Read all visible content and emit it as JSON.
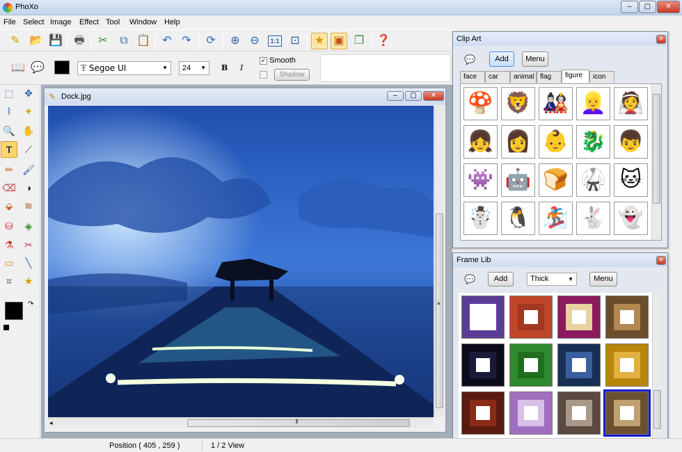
{
  "app": {
    "title": "PhoXo",
    "min": "–",
    "max": "▢",
    "close": "✕"
  },
  "menu": [
    "File",
    "Select",
    "Image",
    "Effect",
    "Tool",
    "Window",
    "Help"
  ],
  "format_bar": {
    "font_glyph": "Ŧ",
    "font_name": "Segoe UI",
    "font_size": "24",
    "bold": "B",
    "italic": "I",
    "smooth_label": "Smooth",
    "smooth_checked": true,
    "shadow_label": "Shadow",
    "shadow_checked": false,
    "text_color": "#000000"
  },
  "document": {
    "title": "Dock.jpg",
    "min": "–",
    "max": "▢",
    "close": "✕"
  },
  "clipart": {
    "title": "Clip Art",
    "close": "✕",
    "add_label": "Add",
    "menu_label": "Menu",
    "tabs": [
      "face",
      "car",
      "animal",
      "flag",
      "figure",
      "icon"
    ],
    "selected_tab": "figure",
    "items": [
      "🍄",
      "🦁",
      "🎎",
      "👱‍♀️",
      "👰",
      "👧",
      "👩",
      "👶",
      "🐉",
      "👦",
      "👾",
      "🤖",
      "🍞",
      "🥋",
      "🐱",
      "☃️",
      "🐧",
      "🏂",
      "🐇",
      "👻"
    ]
  },
  "framelib": {
    "title": "Frame Lib",
    "close": "✕",
    "add_label": "Add",
    "style_value": "Thick",
    "menu_label": "Menu",
    "frames": [
      {
        "outer": "#5a3c96",
        "inner": "#ffffff",
        "center": "#ffffff"
      },
      {
        "outer": "#c0462a",
        "inner": "#a33820",
        "center": "#ffffff"
      },
      {
        "outer": "#8c1a5e",
        "inner": "#e8d2a0",
        "center": "#ffffff"
      },
      {
        "outer": "#6b4d2a",
        "inner": "#b08850",
        "center": "#ffffff"
      },
      {
        "outer": "#0b0b1a",
        "inner": "#1a1a3a",
        "center": "#ffffff"
      },
      {
        "outer": "#2e8a2e",
        "inner": "#1f6e1f",
        "center": "#ffffff"
      },
      {
        "outer": "#1a2f55",
        "inner": "#3a5fa0",
        "center": "#ffffff"
      },
      {
        "outer": "#b8860b",
        "inner": "#e0b040",
        "center": "#ffffff"
      },
      {
        "outer": "#5a1a10",
        "inner": "#8a2a18",
        "center": "#ffffff"
      },
      {
        "outer": "#a070c0",
        "inner": "#d8c0e8",
        "center": "#ffffff"
      },
      {
        "outer": "#5a4a40",
        "inner": "#a89888",
        "center": "#ffffff"
      },
      {
        "outer": "#6b5030",
        "inner": "#c0a070",
        "center": "#ffffff"
      }
    ],
    "selected_frame": 11
  },
  "palette": {
    "foreground": "#000000",
    "background": "#ffffff"
  },
  "status": {
    "position": "Position ( 405 , 259 )",
    "view": "1 / 2 View"
  }
}
